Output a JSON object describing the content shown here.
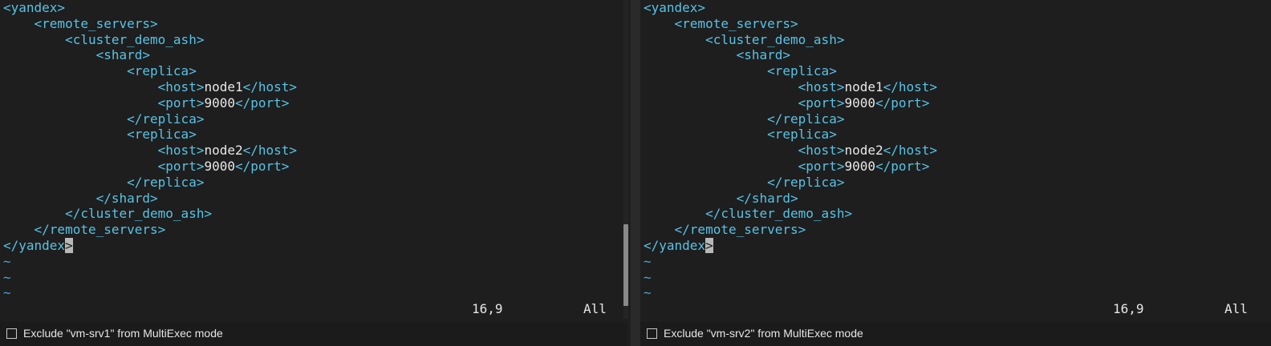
{
  "panes": [
    {
      "id": "vm-srv1",
      "lines": [
        [
          {
            "t": "tag",
            "v": "<yandex>"
          }
        ],
        [
          {
            "t": "tag",
            "v": "    <remote_servers>"
          }
        ],
        [
          {
            "t": "tag",
            "v": "        <cluster_demo_ash>"
          }
        ],
        [
          {
            "t": "tag",
            "v": "            <shard>"
          }
        ],
        [
          {
            "t": "tag",
            "v": "                <replica>"
          }
        ],
        [
          {
            "t": "tag",
            "v": "                    <host>"
          },
          {
            "t": "txt",
            "v": "node1"
          },
          {
            "t": "tag",
            "v": "</host>"
          }
        ],
        [
          {
            "t": "tag",
            "v": "                    <port>"
          },
          {
            "t": "txt",
            "v": "9000"
          },
          {
            "t": "tag",
            "v": "</port>"
          }
        ],
        [
          {
            "t": "tag",
            "v": "                </replica>"
          }
        ],
        [
          {
            "t": "tag",
            "v": "                <replica>"
          }
        ],
        [
          {
            "t": "tag",
            "v": "                    <host>"
          },
          {
            "t": "txt",
            "v": "node2"
          },
          {
            "t": "tag",
            "v": "</host>"
          }
        ],
        [
          {
            "t": "tag",
            "v": "                    <port>"
          },
          {
            "t": "txt",
            "v": "9000"
          },
          {
            "t": "tag",
            "v": "</port>"
          }
        ],
        [
          {
            "t": "tag",
            "v": "                </replica>"
          }
        ],
        [
          {
            "t": "tag",
            "v": "            </shard>"
          }
        ],
        [
          {
            "t": "tag",
            "v": "        </cluster_demo_ash>"
          }
        ],
        [
          {
            "t": "tag",
            "v": "    </remote_servers>"
          }
        ],
        [
          {
            "t": "tag",
            "v": "</yandex"
          },
          {
            "t": "cursor",
            "v": ">"
          }
        ],
        [
          {
            "t": "tilde",
            "v": "~"
          }
        ],
        [
          {
            "t": "tilde",
            "v": "~"
          }
        ],
        [
          {
            "t": "tilde",
            "v": "~"
          }
        ]
      ],
      "position": "16,9",
      "scroll": "All",
      "footer_label": "Exclude \"vm-srv1\" from MultiExec mode"
    },
    {
      "id": "vm-srv2",
      "lines": [
        [
          {
            "t": "tag",
            "v": "<yandex>"
          }
        ],
        [
          {
            "t": "tag",
            "v": "    <remote_servers>"
          }
        ],
        [
          {
            "t": "tag",
            "v": "        <cluster_demo_ash>"
          }
        ],
        [
          {
            "t": "tag",
            "v": "            <shard>"
          }
        ],
        [
          {
            "t": "tag",
            "v": "                <replica>"
          }
        ],
        [
          {
            "t": "tag",
            "v": "                    <host>"
          },
          {
            "t": "txt",
            "v": "node1"
          },
          {
            "t": "tag",
            "v": "</host>"
          }
        ],
        [
          {
            "t": "tag",
            "v": "                    <port>"
          },
          {
            "t": "txt",
            "v": "9000"
          },
          {
            "t": "tag",
            "v": "</port>"
          }
        ],
        [
          {
            "t": "tag",
            "v": "                </replica>"
          }
        ],
        [
          {
            "t": "tag",
            "v": "                <replica>"
          }
        ],
        [
          {
            "t": "tag",
            "v": "                    <host>"
          },
          {
            "t": "txt",
            "v": "node2"
          },
          {
            "t": "tag",
            "v": "</host>"
          }
        ],
        [
          {
            "t": "tag",
            "v": "                    <port>"
          },
          {
            "t": "txt",
            "v": "9000"
          },
          {
            "t": "tag",
            "v": "</port>"
          }
        ],
        [
          {
            "t": "tag",
            "v": "                </replica>"
          }
        ],
        [
          {
            "t": "tag",
            "v": "            </shard>"
          }
        ],
        [
          {
            "t": "tag",
            "v": "        </cluster_demo_ash>"
          }
        ],
        [
          {
            "t": "tag",
            "v": "    </remote_servers>"
          }
        ],
        [
          {
            "t": "tag",
            "v": "</yandex"
          },
          {
            "t": "cursor",
            "v": ">"
          }
        ],
        [
          {
            "t": "tilde",
            "v": "~"
          }
        ],
        [
          {
            "t": "tilde",
            "v": "~"
          }
        ],
        [
          {
            "t": "tilde",
            "v": "~"
          }
        ]
      ],
      "position": "16,9",
      "scroll": "All",
      "footer_label": "Exclude \"vm-srv2\" from MultiExec mode"
    }
  ],
  "colors": {
    "tag": "#56c3e6",
    "text": "#e8e8e8",
    "tilde": "#4aa3d6",
    "background": "#1e1e1e"
  }
}
